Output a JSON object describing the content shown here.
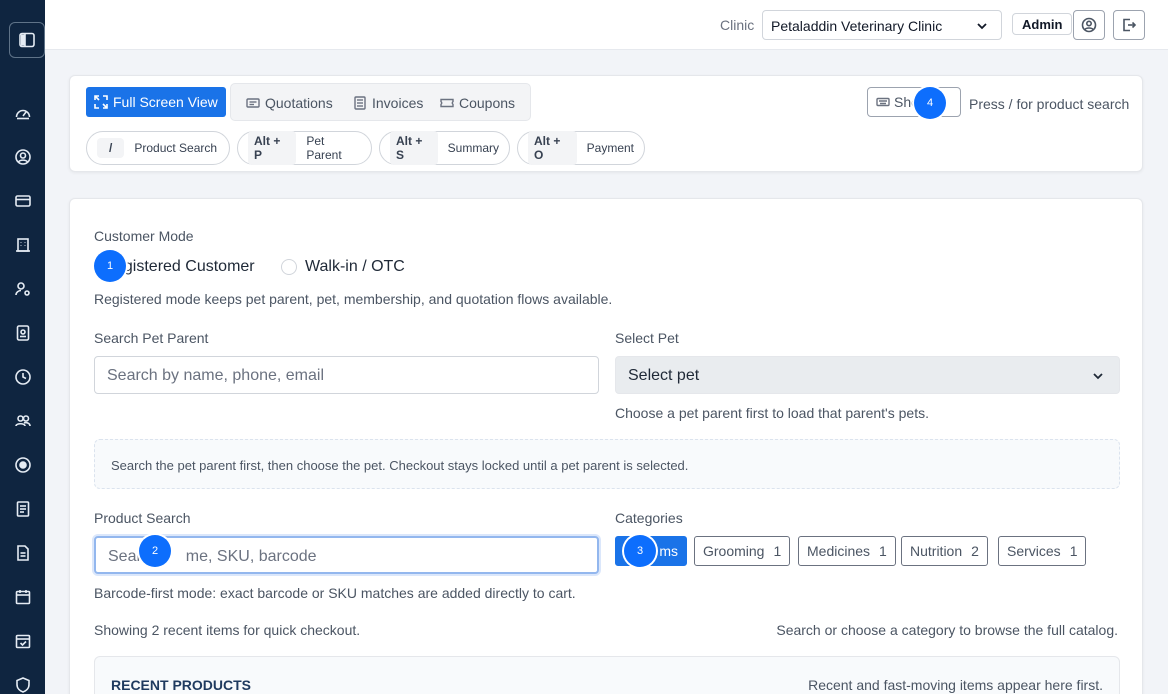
{
  "topbar": {
    "clinic_label": "Clinic",
    "clinic_selected": "Petaladdin Veterinary Clinic",
    "role": "Admin"
  },
  "sidebar": {
    "icons": [
      "gauge-icon",
      "user-circle-icon",
      "credit-card-icon",
      "building-icon",
      "user-cog-icon",
      "id-card-icon",
      "clock-icon",
      "users-icon",
      "target-icon",
      "contacts-icon",
      "document-icon",
      "calendar-icon",
      "calendar-check-icon",
      "shield-icon"
    ]
  },
  "toolbar": {
    "fullscreen_label": "Full Screen View",
    "nav": {
      "quotations": "Quotations",
      "invoices": "Invoices",
      "coupons": "Coupons"
    },
    "shortcuts_label": "Sho",
    "shortcut_hint": "Press / for product search",
    "chips": [
      {
        "key": "/",
        "label": "Product Search"
      },
      {
        "key": "Alt + P",
        "label": "Pet Parent"
      },
      {
        "key": "Alt + S",
        "label": "Summary"
      },
      {
        "key": "Alt + O",
        "label": "Payment"
      }
    ]
  },
  "customer": {
    "mode_label": "Customer Mode",
    "registered_label": "egistered Customer",
    "walkin_label": "Walk-in / OTC",
    "help": "Registered mode keeps pet parent, pet, membership, and quotation flows available."
  },
  "pet_parent": {
    "label": "Search Pet Parent",
    "placeholder": "Search by name, phone, email"
  },
  "pet": {
    "label": "Select Pet",
    "selected": "Select pet",
    "help": "Choose a pet parent first to load that parent's pets."
  },
  "info_message": "Search the pet parent first, then choose the pet. Checkout stays locked until a pet parent is selected.",
  "product": {
    "label": "Product Search",
    "placeholder_left": "Sear",
    "placeholder_right": "me, SKU, barcode",
    "help": "Barcode-first mode: exact barcode or SKU matches are added directly to cart."
  },
  "categories": {
    "label": "Categories",
    "active_label": "ms",
    "items": [
      {
        "name": "Grooming",
        "count": "1"
      },
      {
        "name": "Medicines",
        "count": "1"
      },
      {
        "name": "Nutrition",
        "count": "2"
      },
      {
        "name": "Services",
        "count": "1"
      }
    ]
  },
  "showing_text": "Showing 2 recent items for quick checkout.",
  "browse_text": "Search or choose a category to browse the full catalog.",
  "recent": {
    "title": "RECENT PRODUCTS",
    "note": "Recent and fast-moving items appear here first."
  },
  "markers": [
    "1",
    "2",
    "3",
    "4"
  ],
  "colors": {
    "sidebar": "#0f2540",
    "accent": "#1a73e8",
    "marker": "#0d6efd"
  }
}
